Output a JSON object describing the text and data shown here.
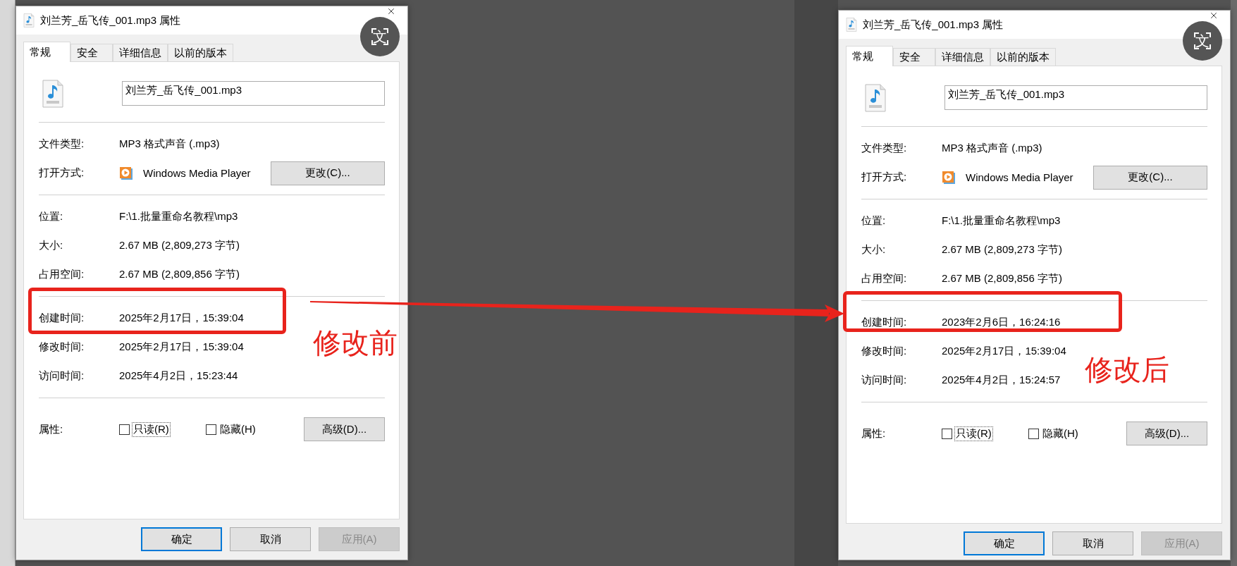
{
  "dialogs": [
    {
      "title": "刘兰芳_岳飞传_001.mp3 属性",
      "translate_button": "文",
      "tabs": [
        {
          "label": "常规",
          "selected": true
        },
        {
          "label": "安全",
          "selected": false
        },
        {
          "label": "详细信息",
          "selected": false
        },
        {
          "label": "以前的版本",
          "selected": false
        }
      ],
      "file_name": "刘兰芳_岳飞传_001.mp3",
      "sections": [
        [
          {
            "kind": "text",
            "label": "文件类型:",
            "value": "MP3 格式声音 (.mp3)"
          },
          {
            "kind": "app",
            "label": "打开方式:",
            "value": "Windows Media Player",
            "button": "更改(C)..."
          }
        ],
        [
          {
            "kind": "text",
            "label": "位置:",
            "value": "F:\\1.批量重命名教程\\mp3"
          },
          {
            "kind": "text",
            "label": "大小:",
            "value": "2.67 MB (2,809,273 字节)"
          },
          {
            "kind": "text",
            "label": "占用空间:",
            "value": "2.67 MB (2,809,856 字节)"
          }
        ],
        [
          {
            "kind": "text",
            "label": "创建时间:",
            "value": "2025年2月17日，15:39:04"
          },
          {
            "kind": "text",
            "label": "修改时间:",
            "value": "2025年2月17日，15:39:04"
          },
          {
            "kind": "text",
            "label": "访问时间:",
            "value": "2025年4月2日，15:23:44"
          }
        ],
        [
          {
            "kind": "attributes",
            "label": "属性:",
            "options": [
              {
                "label": "只读(R)",
                "checked": false,
                "focused": true
              },
              {
                "label": "隐藏(H)",
                "checked": false,
                "focused": false
              }
            ],
            "button": "高级(D)..."
          }
        ]
      ],
      "buttons": [
        {
          "label": "确定",
          "default": true,
          "disabled": false
        },
        {
          "label": "取消",
          "default": false,
          "disabled": false
        },
        {
          "label": "应用(A)",
          "default": false,
          "disabled": true
        }
      ]
    },
    {
      "title": "刘兰芳_岳飞传_001.mp3 属性",
      "translate_button": "文",
      "tabs": [
        {
          "label": "常规",
          "selected": true
        },
        {
          "label": "安全",
          "selected": false
        },
        {
          "label": "详细信息",
          "selected": false
        },
        {
          "label": "以前的版本",
          "selected": false
        }
      ],
      "file_name": "刘兰芳_岳飞传_001.mp3",
      "sections": [
        [
          {
            "kind": "text",
            "label": "文件类型:",
            "value": "MP3 格式声音 (.mp3)"
          },
          {
            "kind": "app",
            "label": "打开方式:",
            "value": "Windows Media Player",
            "button": "更改(C)..."
          }
        ],
        [
          {
            "kind": "text",
            "label": "位置:",
            "value": "F:\\1.批量重命名教程\\mp3"
          },
          {
            "kind": "text",
            "label": "大小:",
            "value": "2.67 MB (2,809,273 字节)"
          },
          {
            "kind": "text",
            "label": "占用空间:",
            "value": "2.67 MB (2,809,856 字节)"
          }
        ],
        [
          {
            "kind": "text",
            "label": "创建时间:",
            "value": "2023年2月6日，16:24:16"
          },
          {
            "kind": "text",
            "label": "修改时间:",
            "value": "2025年2月17日，15:39:04"
          },
          {
            "kind": "text",
            "label": "访问时间:",
            "value": "2025年4月2日，15:24:57"
          }
        ],
        [
          {
            "kind": "attributes",
            "label": "属性:",
            "options": [
              {
                "label": "只读(R)",
                "checked": false,
                "focused": true
              },
              {
                "label": "隐藏(H)",
                "checked": false,
                "focused": false
              }
            ],
            "button": "高级(D)..."
          }
        ]
      ],
      "buttons": [
        {
          "label": "确定",
          "default": true,
          "disabled": false
        },
        {
          "label": "取消",
          "default": false,
          "disabled": false
        },
        {
          "label": "应用(A)",
          "default": false,
          "disabled": true
        }
      ]
    }
  ],
  "annotations": {
    "before_label": "修改前",
    "after_label": "修改后"
  }
}
